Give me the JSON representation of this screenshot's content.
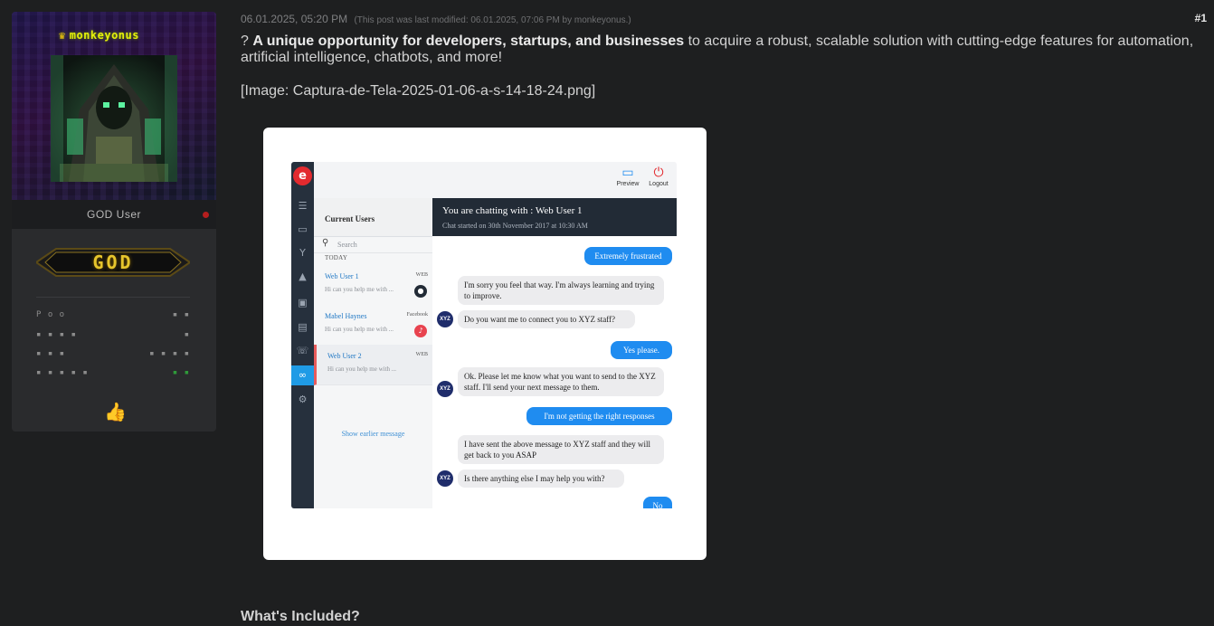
{
  "user": {
    "username": "monkeyonus",
    "title": "GOD User",
    "rank": "GOD",
    "stats": [
      {
        "label": "P o o",
        "value": "▪ ▪"
      },
      {
        "label": "▪ ▪ ▪ ▪",
        "value": "▪"
      },
      {
        "label": "▪ ▪ ▪",
        "value": "▪ ▪ ▪ ▪"
      },
      {
        "label": "▪ ▪ ▪ ▪ ▪",
        "value": "▪ ▪"
      }
    ],
    "online_color": "#b51e1e"
  },
  "post": {
    "date": "06.01.2025, 05:20 PM",
    "edit_note": "(This post was last modified: 06.01.2025, 07:06 PM by monkeyonus.)",
    "number": "#1",
    "intro_prefix": "? ",
    "intro_bold": "A unique opportunity for developers, startups, and businesses",
    "intro_rest": " to acquire a robust, scalable solution with cutting-edge features for automation, artificial intelligence, chatbots, and more!",
    "image_caption": "[Image: Captura-de-Tela-2025-01-06-a-s-14-18-24.png]",
    "section_heading": "What's Included?"
  },
  "chat_app": {
    "topbar": {
      "preview": "Preview",
      "logout": "Logout"
    },
    "users_panel_title": "Current Users",
    "search_placeholder": "Search",
    "today_label": "TODAY",
    "users": [
      {
        "name": "Web User 1",
        "source": "WEB",
        "preview": "Hi can you help me with ...",
        "badge_color": "#222b36"
      },
      {
        "name": "Mabel Haynes",
        "source": "Facebook",
        "preview": "Hi can you help me with ...",
        "badge_color": "#e8434f"
      },
      {
        "name": "Web User 2",
        "source": "WEB",
        "preview": "Hi can you help me with ..."
      }
    ],
    "show_earlier": "Show earlier message",
    "chat_header_title": "You are chatting with : Web User 1",
    "chat_header_sub": "Chat started on 30th November 2017 at 10:30 AM",
    "avatar_label": "XYZ",
    "messages": [
      {
        "dir": "out",
        "text": "Extremely frustrated"
      },
      {
        "dir": "in",
        "text": "I'm sorry you feel that way. I'm always learning and trying to improve."
      },
      {
        "dir": "in",
        "text": "Do you want me to connect you to XYZ staff?"
      },
      {
        "dir": "out",
        "text": "Yes please."
      },
      {
        "dir": "in",
        "text": "Ok. Please let me know what you want to send to the XYZ staff. I'll send your next message to them."
      },
      {
        "dir": "out",
        "text": "I'm not getting the right responses"
      },
      {
        "dir": "in",
        "text": "I have sent the above message to XYZ staff and they will get back to you ASAP"
      },
      {
        "dir": "in",
        "text": "Is there anything else I may help you with?"
      },
      {
        "dir": "out",
        "text": "No"
      }
    ]
  }
}
